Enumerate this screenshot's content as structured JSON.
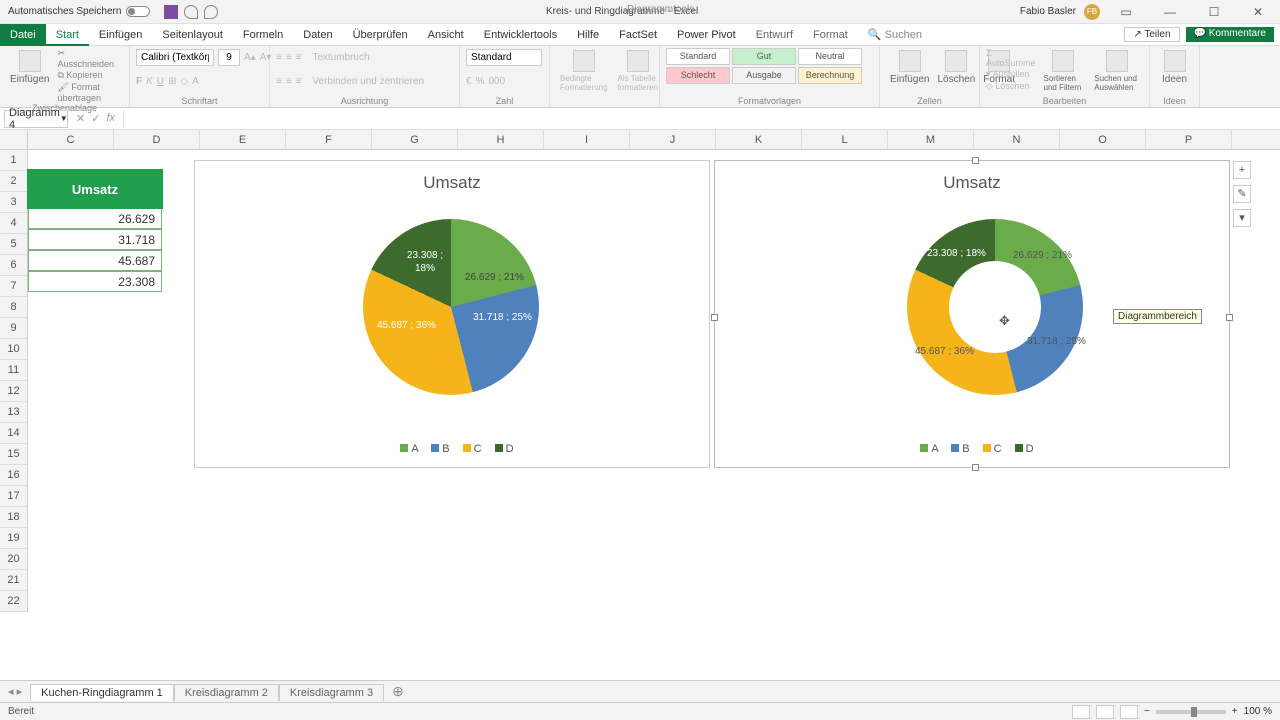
{
  "titlebar": {
    "autosave_label": "Automatisches Speichern",
    "doc_title": "Kreis- und Ringdiagramme  -  Excel",
    "tools_label": "Diagrammtools",
    "user_name": "Fabio Basler",
    "user_initials": "FB"
  },
  "ribbon_tabs": {
    "file": "Datei",
    "home": "Start",
    "insert": "Einfügen",
    "pagelayout": "Seitenlayout",
    "formulas": "Formeln",
    "data": "Daten",
    "review": "Überprüfen",
    "view": "Ansicht",
    "developer": "Entwicklertools",
    "help": "Hilfe",
    "factset": "FactSet",
    "powerpivot": "Power Pivot",
    "design": "Entwurf",
    "format": "Format",
    "search": "Suchen",
    "share": "Teilen",
    "comments": "Kommentare"
  },
  "ribbon": {
    "paste": "Einfügen",
    "cut": "Ausschneiden",
    "copy": "Kopieren",
    "formatpainter": "Format übertragen",
    "g_clipboard": "Zwischenablage",
    "font_name": "Calibri (Textkörpe",
    "font_size": "9",
    "g_font": "Schriftart",
    "wrap": "Textumbruch",
    "merge": "Verbinden und zentrieren",
    "g_align": "Ausrichtung",
    "numfmt": "Standard",
    "g_number": "Zahl",
    "condfmt": "Bedingte Formatierung",
    "astable": "Als Tabelle formatieren",
    "style_std": "Standard",
    "style_gut": "Gut",
    "style_schlecht": "Schlecht",
    "style_ausgabe": "Ausgabe",
    "style_neutral": "Neutral",
    "style_berechnung": "Berechnung",
    "g_styles": "Formatvorlagen",
    "ins": "Einfügen",
    "del": "Löschen",
    "fmt": "Format",
    "g_cells": "Zellen",
    "autosum": "AutoSumme",
    "fill": "Ausfüllen",
    "clear": "Löschen",
    "sort": "Sortieren und Filtern",
    "find": "Suchen und Auswählen",
    "g_edit": "Bearbeiten",
    "ideas": "Ideen",
    "g_ideas": "Ideen"
  },
  "namebox": "Diagramm 4",
  "columns": [
    "C",
    "D",
    "E",
    "F",
    "G",
    "H",
    "I",
    "J",
    "K",
    "L",
    "M",
    "N",
    "O",
    "P"
  ],
  "rows": [
    "1",
    "2",
    "3",
    "4",
    "5",
    "6",
    "7",
    "8",
    "9",
    "10",
    "11",
    "12",
    "13",
    "14",
    "15",
    "16",
    "17",
    "18",
    "19",
    "20",
    "21",
    "22"
  ],
  "table": {
    "header": "Umsatz",
    "values": [
      "26.629",
      "31.718",
      "45.687",
      "23.308"
    ]
  },
  "chart_data": [
    {
      "type": "pie",
      "title": "Umsatz",
      "series": [
        {
          "name": "Umsatz",
          "values": [
            26629,
            31718,
            45687,
            23308
          ]
        }
      ],
      "categories": [
        "A",
        "B",
        "C",
        "D"
      ],
      "labels": [
        "26.629 ; 21%",
        "31.718 ; 25%",
        "45.687 ; 36%",
        "23.308 ; 18%"
      ],
      "colors": [
        "#6aab4b",
        "#4f81bd",
        "#f4b41a",
        "#3d6b2e"
      ]
    },
    {
      "type": "doughnut",
      "title": "Umsatz",
      "series": [
        {
          "name": "Umsatz",
          "values": [
            26629,
            31718,
            45687,
            23308
          ]
        }
      ],
      "categories": [
        "A",
        "B",
        "C",
        "D"
      ],
      "labels": [
        "26.629 ; 21%",
        "31.718 ; 25%",
        "45.687 ; 36%",
        "23.308 ; 18%"
      ],
      "colors": [
        "#6aab4b",
        "#4f81bd",
        "#f4b41a",
        "#3d6b2e"
      ]
    }
  ],
  "tooltip": "Diagrammbereich",
  "sheets": {
    "s1": "Kuchen-Ringdiagramm 1",
    "s2": "Kreisdiagramm 2",
    "s3": "Kreisdiagramm 3"
  },
  "status": {
    "ready": "Bereit",
    "zoom": "100 %"
  }
}
